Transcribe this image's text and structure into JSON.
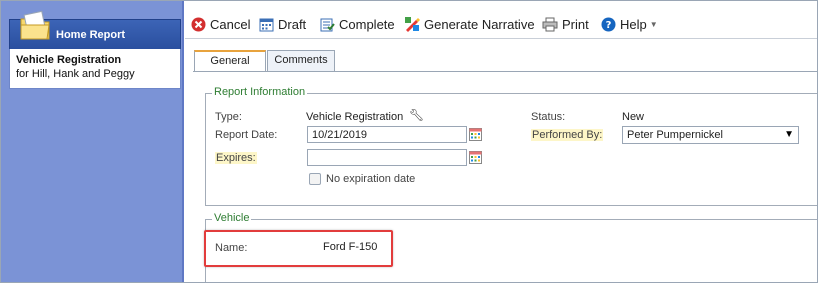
{
  "sidebar": {
    "panel_title": "Home Report",
    "report_name": "Vehicle Registration",
    "report_subject": "for Hill, Hank and Peggy"
  },
  "toolbar": {
    "cancel": "Cancel",
    "draft": "Draft",
    "complete": "Complete",
    "generate_narrative": "Generate Narrative",
    "print": "Print",
    "help": "Help"
  },
  "tabs": {
    "general": "General",
    "comments": "Comments"
  },
  "report_info": {
    "legend": "Report Information",
    "type_label": "Type:",
    "type_value": "Vehicle Registration",
    "report_date_label": "Report Date:",
    "report_date_value": "10/21/2019",
    "expires_label": "Expires:",
    "expires_value": "",
    "no_expiration_label": "No expiration date",
    "status_label": "Status:",
    "status_value": "New",
    "performed_by_label": "Performed By:",
    "performed_by_value": "Peter Pumpernickel"
  },
  "vehicle": {
    "legend": "Vehicle",
    "name_label": "Name:",
    "name_value": "Ford F-150"
  },
  "colors": {
    "sidebar_bg": "#7b93d6",
    "legend_green": "#2e7d32",
    "highlight": "#e23c3c",
    "tab_accent": "#e8a33d"
  }
}
